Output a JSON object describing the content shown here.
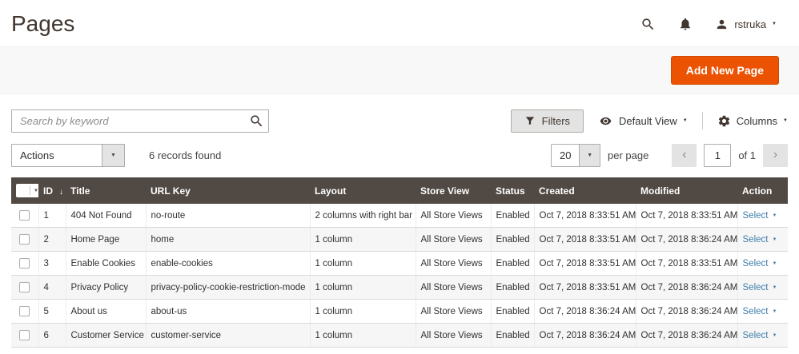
{
  "page_title": "Pages",
  "top_nav": {
    "username": "rstruka"
  },
  "page_actions": {
    "add_new_page": "Add New Page"
  },
  "grid_toolbar": {
    "search_placeholder": "Search by keyword",
    "filters": "Filters",
    "default_view": "Default View",
    "columns": "Columns"
  },
  "bulk_bar": {
    "actions": "Actions",
    "records_found": "6 records found",
    "per_page_value": "20",
    "per_page_label": "per page",
    "page_value": "1",
    "page_total": "of 1"
  },
  "table": {
    "headers": {
      "id": "ID",
      "title": "Title",
      "url_key": "URL Key",
      "layout": "Layout",
      "store_view": "Store View",
      "status": "Status",
      "created": "Created",
      "modified": "Modified",
      "action": "Action"
    },
    "sort_indicator": "↓",
    "rows": [
      {
        "id": "1",
        "title": "404 Not Found",
        "url_key": "no-route",
        "layout": "2 columns with right bar",
        "store_view": "All Store Views",
        "status": "Enabled",
        "created": "Oct 7, 2018 8:33:51 AM",
        "modified": "Oct 7, 2018 8:33:51 AM",
        "action": "Select"
      },
      {
        "id": "2",
        "title": "Home Page",
        "url_key": "home",
        "layout": "1 column",
        "store_view": "All Store Views",
        "status": "Enabled",
        "created": "Oct 7, 2018 8:33:51 AM",
        "modified": "Oct 7, 2018 8:36:24 AM",
        "action": "Select"
      },
      {
        "id": "3",
        "title": "Enable Cookies",
        "url_key": "enable-cookies",
        "layout": "1 column",
        "store_view": "All Store Views",
        "status": "Enabled",
        "created": "Oct 7, 2018 8:33:51 AM",
        "modified": "Oct 7, 2018 8:33:51 AM",
        "action": "Select"
      },
      {
        "id": "4",
        "title": "Privacy Policy",
        "url_key": "privacy-policy-cookie-restriction-mode",
        "layout": "1 column",
        "store_view": "All Store Views",
        "status": "Enabled",
        "created": "Oct 7, 2018 8:33:51 AM",
        "modified": "Oct 7, 2018 8:36:24 AM",
        "action": "Select"
      },
      {
        "id": "5",
        "title": "About us",
        "url_key": "about-us",
        "layout": "1 column",
        "store_view": "All Store Views",
        "status": "Enabled",
        "created": "Oct 7, 2018 8:36:24 AM",
        "modified": "Oct 7, 2018 8:36:24 AM",
        "action": "Select"
      },
      {
        "id": "6",
        "title": "Customer Service",
        "url_key": "customer-service",
        "layout": "1 column",
        "store_view": "All Store Views",
        "status": "Enabled",
        "created": "Oct 7, 2018 8:36:24 AM",
        "modified": "Oct 7, 2018 8:36:24 AM",
        "action": "Select"
      }
    ]
  },
  "colors": {
    "accent": "#eb5202",
    "table_header_bg": "#514943",
    "link": "#3d7eab"
  }
}
